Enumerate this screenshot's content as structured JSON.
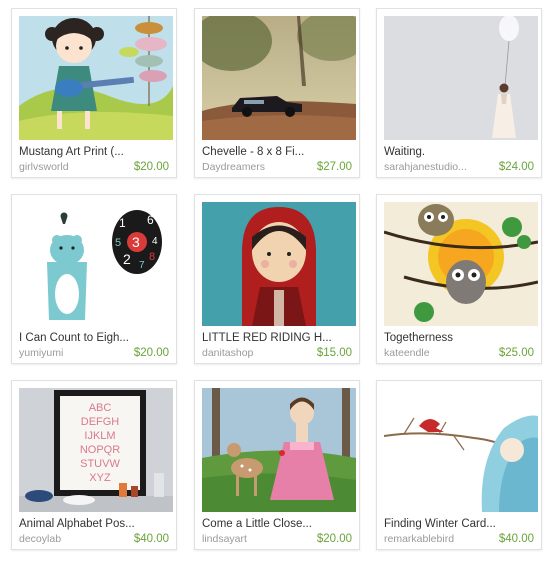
{
  "listings": [
    {
      "title": "Mustang Art Print (...",
      "shop": "girlvsworld",
      "price": "$20.00"
    },
    {
      "title": "Chevelle - 8 x 8 Fi...",
      "shop": "Daydreamers",
      "price": "$27.00"
    },
    {
      "title": "Waiting.",
      "shop": "sarahjanestudio...",
      "price": "$24.00"
    },
    {
      "title": "I Can Count to Eigh...",
      "shop": "yumiyumi",
      "price": "$20.00"
    },
    {
      "title": "LITTLE RED RIDING H...",
      "shop": "danitashop",
      "price": "$15.00"
    },
    {
      "title": "Togetherness",
      "shop": "kateendle",
      "price": "$25.00"
    },
    {
      "title": "Animal Alphabet Pos...",
      "shop": "decoylab",
      "price": "$40.00"
    },
    {
      "title": "Come a Little Close...",
      "shop": "lindsayart",
      "price": "$20.00"
    },
    {
      "title": "Finding Winter Card...",
      "shop": "remarkablebird",
      "price": "$40.00"
    }
  ],
  "poster_letters": [
    "ABC",
    "DEFGH",
    "IJKLM",
    "NOPQR",
    "STUVW",
    "XYZ"
  ],
  "counting_digits": [
    "1",
    "6",
    "3",
    "5",
    "2",
    "8",
    "4",
    "7"
  ],
  "colors": {
    "price": "#6aa43a",
    "title": "#333333",
    "shop": "#9a9a9a"
  }
}
